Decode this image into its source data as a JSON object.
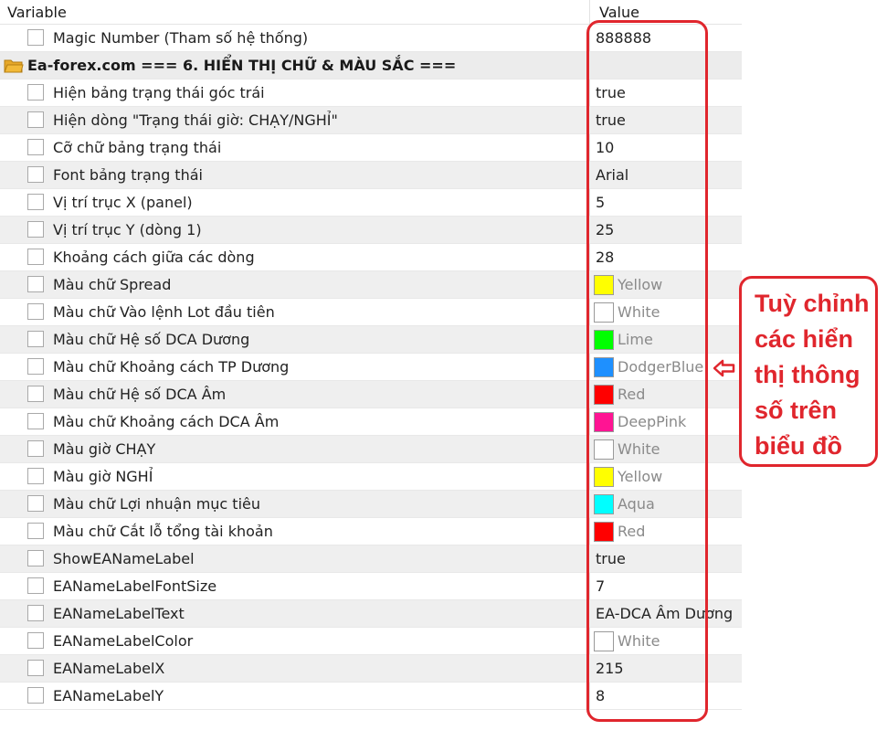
{
  "header": {
    "variable_label": "Variable",
    "value_label": "Value"
  },
  "rows": [
    {
      "label": "Magic Number (Tham số hệ thống)",
      "value": "888888"
    },
    {
      "section": true,
      "label": "Ea-forex.com   === 6. HIỂN THỊ CHỮ & MÀU SẮC ===",
      "value": ""
    },
    {
      "label": "Hiện bảng trạng thái góc trái",
      "value": "true"
    },
    {
      "label": "Hiện dòng \"Trạng thái giờ: CHẠY/NGHỈ\"",
      "value": "true"
    },
    {
      "label": "Cỡ chữ bảng trạng thái",
      "value": "10"
    },
    {
      "label": "Font bảng trạng thái",
      "value": "Arial"
    },
    {
      "label": "Vị trí trục X (panel)",
      "value": "5"
    },
    {
      "label": "Vị trí trục Y (dòng 1)",
      "value": "25"
    },
    {
      "label": "Khoảng cách giữa các dòng",
      "value": "28"
    },
    {
      "label": "Màu chữ Spread",
      "value": "Yellow",
      "color": "#ffff00"
    },
    {
      "label": "Màu chữ Vào lệnh Lot đầu tiên",
      "value": "White",
      "color": "#ffffff"
    },
    {
      "label": "Màu chữ Hệ số DCA Dương",
      "value": "Lime",
      "color": "#00ff00"
    },
    {
      "label": "Màu chữ Khoảng cách TP Dương",
      "value": "DodgerBlue",
      "color": "#1e90ff"
    },
    {
      "label": "Màu chữ Hệ số DCA Âm",
      "value": "Red",
      "color": "#ff0000"
    },
    {
      "label": "Màu chữ Khoảng cách DCA Âm",
      "value": "DeepPink",
      "color": "#ff1493"
    },
    {
      "label": "Màu giờ CHẠY",
      "value": "White",
      "color": "#ffffff"
    },
    {
      "label": "Màu giờ NGHỈ",
      "value": "Yellow",
      "color": "#ffff00"
    },
    {
      "label": "Màu chữ Lợi nhuận mục tiêu",
      "value": "Aqua",
      "color": "#00ffff"
    },
    {
      "label": "Màu chữ Cắt lỗ tổng tài khoản",
      "value": "Red",
      "color": "#ff0000"
    },
    {
      "label": "ShowEANameLabel",
      "value": "true"
    },
    {
      "label": "EANameLabelFontSize",
      "value": "7"
    },
    {
      "label": "EANameLabelText",
      "value": "EA-DCA Âm Dương"
    },
    {
      "label": "EANameLabelColor",
      "value": "White",
      "color": "#ffffff"
    },
    {
      "label": "EANameLabelX",
      "value": "215"
    },
    {
      "label": "EANameLabelY",
      "value": "8"
    }
  ],
  "callout": {
    "text": "Tuỳ chỉnh\ncác hiển\nthị thông\nsố trên\nbiểu đồ"
  },
  "colors": {
    "accent": "#e0262d",
    "folder": "#f2b938",
    "alt_row": "#efefef"
  }
}
